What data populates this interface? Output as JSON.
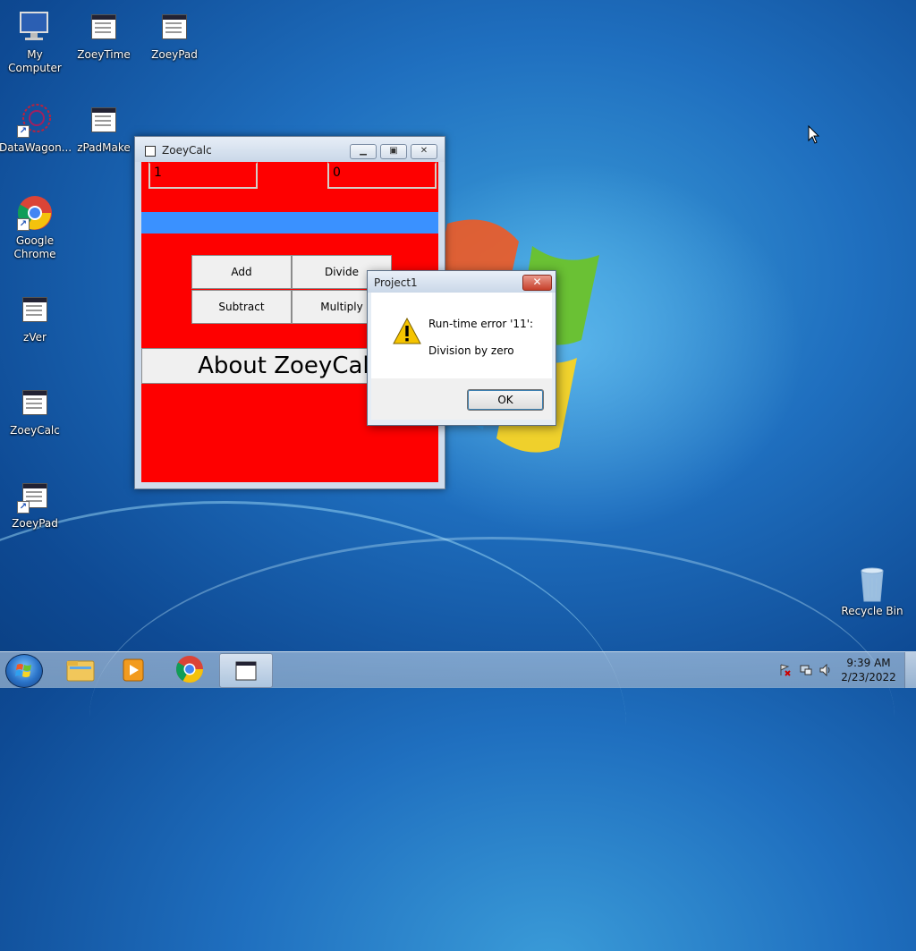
{
  "desktop": {
    "icons": [
      {
        "label": "My Computer"
      },
      {
        "label": "ZoeyTime"
      },
      {
        "label": "ZoeyPad"
      },
      {
        "label": "DataWagon..."
      },
      {
        "label": "zPadMake"
      },
      {
        "label": "Google\nChrome"
      },
      {
        "label": "zVer"
      },
      {
        "label": "ZoeyCalc"
      },
      {
        "label": "ZoeyPad"
      },
      {
        "label": "Recycle Bin"
      }
    ]
  },
  "calc_window": {
    "title": "ZoeyCalc",
    "field1_value": "1",
    "field2_value": "0",
    "buttons": {
      "add": "Add",
      "divide": "Divide",
      "subtract": "Subtract",
      "multiply": "Multiply"
    },
    "about_label": "About ZoeyCalc",
    "colors": {
      "background": "#fe0000",
      "band": "#3a91ff"
    }
  },
  "dialog": {
    "title": "Project1",
    "message_line1": "Run-time error '11':",
    "message_line2": "Division by zero",
    "ok_label": "OK",
    "close_glyph": "✕"
  },
  "taskbar": {
    "clock_time": "9:39 AM",
    "clock_date": "2/23/2022"
  }
}
